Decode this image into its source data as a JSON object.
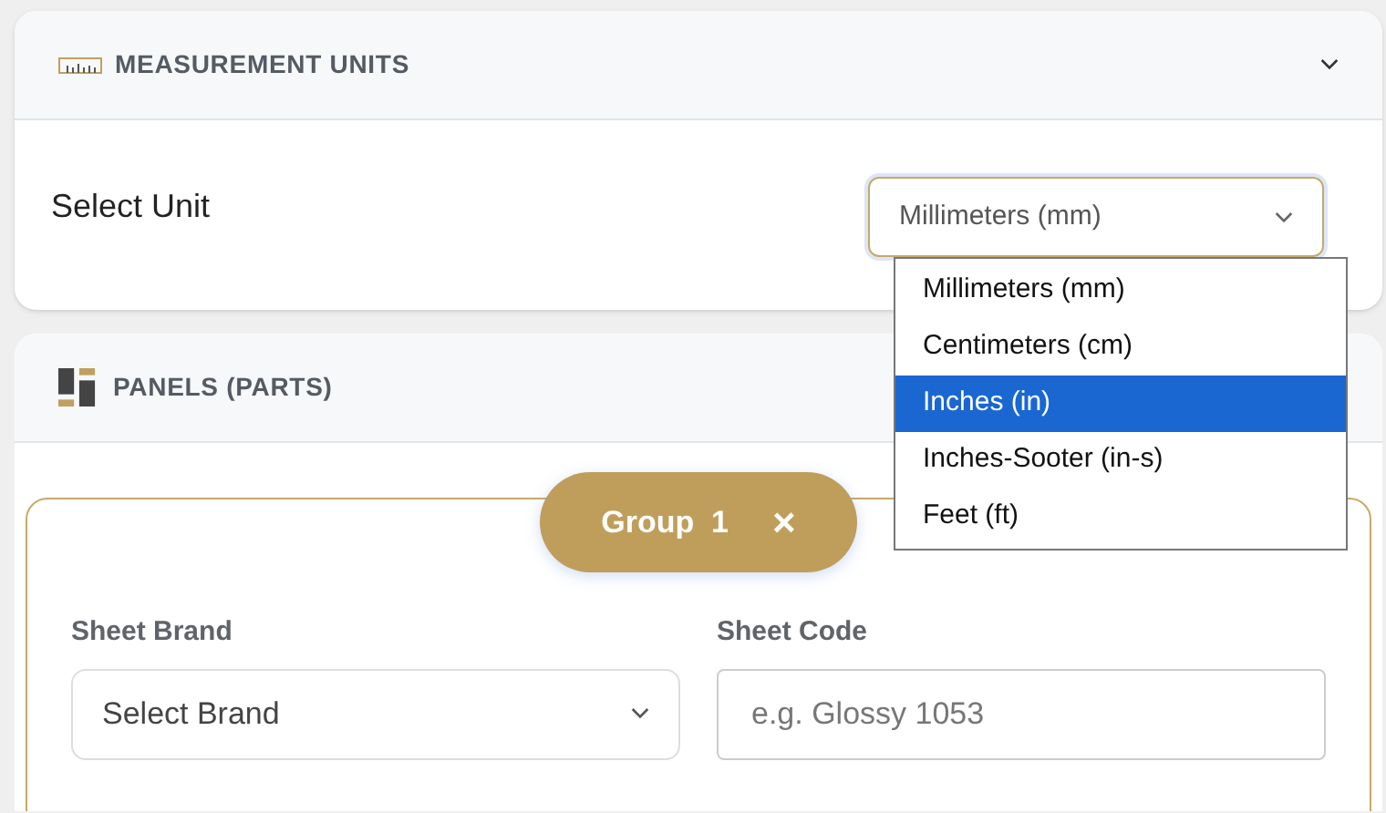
{
  "measurement_section": {
    "title": "MEASUREMENT UNITS",
    "expanded": true,
    "unit_label": "Select Unit",
    "unit_select": {
      "value": "Millimeters (mm)",
      "open": true,
      "options": [
        {
          "label": "Millimeters (mm)",
          "highlighted": false
        },
        {
          "label": "Centimeters (cm)",
          "highlighted": false
        },
        {
          "label": "Inches (in)",
          "highlighted": true
        },
        {
          "label": "Inches-Sooter (in-s)",
          "highlighted": false
        },
        {
          "label": "Feet (ft)",
          "highlighted": false
        }
      ]
    }
  },
  "panels_section": {
    "title": "PANELS (PARTS)",
    "group": {
      "label": "Group  1",
      "close": "×",
      "fields": [
        {
          "kind": "select",
          "label": "Sheet Brand",
          "value": "Select Brand"
        },
        {
          "kind": "text",
          "label": "Sheet Code",
          "placeholder": "e.g. Glossy 1053"
        }
      ]
    }
  }
}
